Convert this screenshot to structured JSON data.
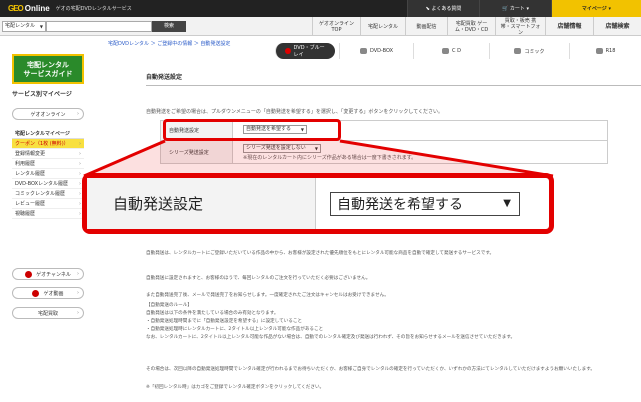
{
  "header": {
    "logo_mark": "GEO",
    "logo_word": "Online",
    "site_title": "ゲオの宅配DVDレンタルサービス",
    "faq": "よくある質問",
    "cart": "カート",
    "mypage": "マイページ"
  },
  "search": {
    "category": "宅配レンタル",
    "button": "検索"
  },
  "service_tabs": [
    "ゲオオンライン TOP",
    "宅配レンタル",
    "動画配信",
    "宅配買取 ゲーム・DVD・CD",
    "買取・販売 携帯・スマートフォン",
    "店舗情報",
    "店舗検索"
  ],
  "breadcrumb": "宅配DVDレンタル ＞ ご登録中の情報 ＞ 自動発送設定",
  "category_tabs": [
    "DVD・ブルーレイ",
    "DVD-BOX",
    "C D",
    "コミック",
    "R18"
  ],
  "sidebar": {
    "banner_line1": "宅配レンタル",
    "banner_line2": "サービスガイド",
    "title": "サービス別マイページ",
    "geo_online": "ゲオオンライン",
    "list_head": "宅配レンタルマイページ",
    "items": [
      "クーポン（1枚 (無料)）",
      "登録情報変更",
      "利用履歴",
      "レンタル履歴",
      "DVD-BOXレンタル履歴",
      "コミックレンタル履歴",
      "レビュー履歴",
      "視聴履歴"
    ],
    "geo_channel": "ゲオチャンネル",
    "geo_video": "ゲオ動画",
    "takuhai_kaitori": "宅配買取"
  },
  "main": {
    "title": "自動発送設定",
    "intro": "自動発送をご希望の場合は、プルダウンメニューの「自動発送を希望する」を選択し、「変更する」ボタンをクリックしてください。",
    "row1_label": "自動発送設定",
    "row1_value": "自動発送を希望する",
    "row2_label": "シリーズ発送設定",
    "row2_value": "シリーズ発送を設定しない",
    "row2_note": "※現在のレンタルカート内にシリーズ作品がある場合は一度下書きされます。",
    "zoom_label": "自動発送設定",
    "zoom_value": "自動発送を希望する",
    "paragraphs": [
      "自動発送は、レンタルカートにご登録いただいている作品の中から、お客様が設定された優先順位をもとにレンタル可能な商品を自動で確定して発送するサービスです。",
      "自動発送に設定されますと、お客様のほうで、毎回レンタルのご注文を行っていただく必要はございません。",
      "また自動発送完了後、メールで発送完了をお知らせします。一度確定されたご注文はキャンセルはお受けできません。",
      "【自動発送のルール】",
      "自動発送は以下の条件を満たしている場合のみ有効となります。",
      "・自動発送処理時間までに「自動発送設定を希望する」に設定していること",
      "・自動発送処理時にレンタルカートに、2タイトル以上レンタル可能な作品があること",
      "なお、レンタルカートに、2タイトル以上レンタル可能な作品がない場合は、自動でのレンタル確定及び発送は行われず、その旨をお知らせするメールを送信させていただきます。",
      "その場合は、次回以降の自動発送処理時間でレンタル確定が行われるまでお待ちいただくか、お客様ご自身でレンタルの確定を行っていただくか、いずれかの方法にてレンタルしていただけますようお願いいたします。",
      "※「初回レンタル時」はカゴをご登録でレンタル確定ボタンをクリックしてください。"
    ]
  },
  "colors": {
    "accent": "#e30000",
    "brand": "#f2c200",
    "link": "#2a5bc8"
  }
}
